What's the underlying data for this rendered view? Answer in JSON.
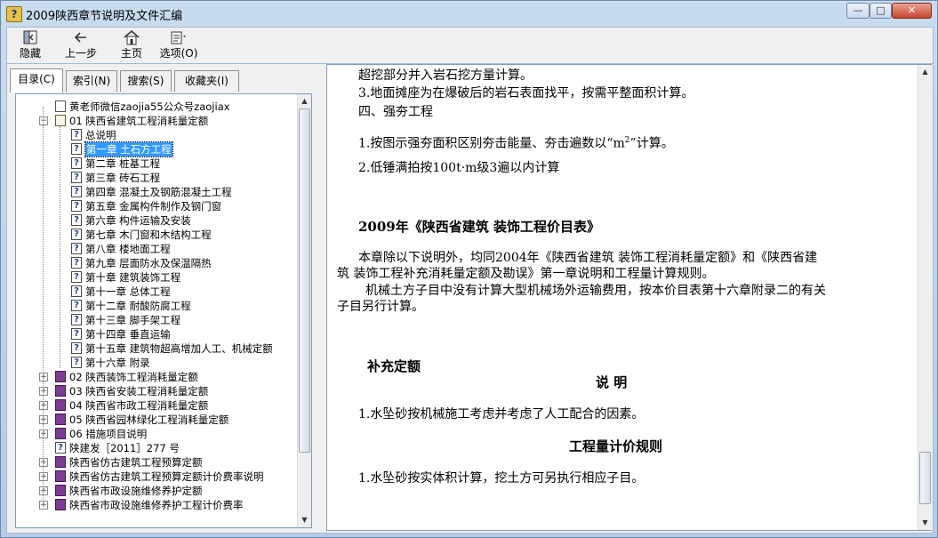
{
  "window": {
    "title": "2009陕西章节说明及文件汇编",
    "app_icon_glyph": "?",
    "buttons": {
      "minimize": "—",
      "maximize": "□",
      "close": "✕"
    }
  },
  "toolbar": {
    "hide": {
      "label": "隐藏",
      "icon": "hide-icon"
    },
    "back": {
      "label": "上一步",
      "icon": "back-arrow-icon"
    },
    "home": {
      "label": "主页",
      "icon": "home-icon"
    },
    "options": {
      "label": "选项(O)",
      "icon": "options-icon"
    }
  },
  "tabs": [
    {
      "label": "目录(C)",
      "active": true
    },
    {
      "label": "索引(N)",
      "active": false
    },
    {
      "label": "搜索(S)",
      "active": false
    },
    {
      "label": "收藏夹(I)",
      "active": false
    }
  ],
  "tree": [
    {
      "label": "黄老师微信zaojia55公众号zaojiax",
      "icon": "doc-icon",
      "level": 0
    },
    {
      "label": "01 陕西省建筑工程消耗量定额",
      "icon": "open-book-icon",
      "level": 0,
      "toggle": "−"
    },
    {
      "label": "总说明",
      "icon": "help-icon",
      "level": 1
    },
    {
      "label": "第一章 土石方工程",
      "icon": "help-icon",
      "level": 1,
      "selected": true
    },
    {
      "label": "第二章 桩基工程",
      "icon": "help-icon",
      "level": 1
    },
    {
      "label": "第三章 砖石工程",
      "icon": "help-icon",
      "level": 1
    },
    {
      "label": "第四章 混凝土及钢筋混凝土工程",
      "icon": "help-icon",
      "level": 1
    },
    {
      "label": "第五章 金属构件制作及钢门窗",
      "icon": "help-icon",
      "level": 1
    },
    {
      "label": "第六章 构件运输及安装",
      "icon": "help-icon",
      "level": 1
    },
    {
      "label": "第七章 木门窗和木结构工程",
      "icon": "help-icon",
      "level": 1
    },
    {
      "label": "第八章 楼地面工程",
      "icon": "help-icon",
      "level": 1
    },
    {
      "label": "第九章 层面防水及保温隔热",
      "icon": "help-icon",
      "level": 1
    },
    {
      "label": "第十章 建筑装饰工程",
      "icon": "help-icon",
      "level": 1
    },
    {
      "label": "第十一章 总体工程",
      "icon": "help-icon",
      "level": 1
    },
    {
      "label": "第十二章 耐酸防腐工程",
      "icon": "help-icon",
      "level": 1
    },
    {
      "label": "第十三章 脚手架工程",
      "icon": "help-icon",
      "level": 1
    },
    {
      "label": "第十四章 垂直运输",
      "icon": "help-icon",
      "level": 1
    },
    {
      "label": "第十五章 建筑物超高增加人工、机械定额",
      "icon": "help-icon",
      "level": 1
    },
    {
      "label": "第十六章 附录",
      "icon": "help-icon",
      "level": 1
    },
    {
      "label": "02 陕西装饰工程消耗量定额",
      "icon": "book-icon",
      "level": 0,
      "toggle": "+"
    },
    {
      "label": "03 陕西省安装工程消耗量定额",
      "icon": "book-icon",
      "level": 0,
      "toggle": "+"
    },
    {
      "label": "04 陕西省市政工程消耗量定额",
      "icon": "book-icon",
      "level": 0,
      "toggle": "+"
    },
    {
      "label": "05 陕西省园林绿化工程消耗量定额",
      "icon": "book-icon",
      "level": 0,
      "toggle": "+"
    },
    {
      "label": "06 措施项目说明",
      "icon": "book-icon",
      "level": 0,
      "toggle": "+"
    },
    {
      "label": "陕建发［2011］277 号",
      "icon": "help-icon",
      "level": 0
    },
    {
      "label": "陕西省仿古建筑工程预算定额",
      "icon": "book-icon",
      "level": 0,
      "toggle": "+"
    },
    {
      "label": "陕西省仿古建筑工程预算定额计价费率说明",
      "icon": "book-icon",
      "level": 0,
      "toggle": "+"
    },
    {
      "label": "陕西省市政设施维修养护定额",
      "icon": "book-icon",
      "level": 0,
      "toggle": "+"
    },
    {
      "label": "陕西省市政设施维修养护工程计价费率",
      "icon": "book-icon",
      "level": 0,
      "toggle": "+"
    }
  ],
  "content": {
    "line1": "超挖部分并入岩石挖方量计算。",
    "line2": "3.地面摊座为在爆破后的岩石表面找平，按需平整面积计算。",
    "line3": "四、强夯工程",
    "line4_pre": "1.按图示强夯面积区别夯击能量、夯击遍数以“m",
    "line4_sup": "2",
    "line4_post": "”计算。",
    "line5": "2.低锤满拍按100t·m级3遍以内计算",
    "heading1": "2009年《陕西省建筑 装饰工程价目表》",
    "para1a": "本章除以下说明外，均同2004年《陕西省建筑 装饰工程消耗量定额》和《陕西省建",
    "para1b": "筑  装饰工程补充消耗量定额及勘误》第一章说明和工程量计算规则。",
    "para2a": "机械土方子目中没有计算大型机械场外运输费用，按本价目表第十六章附录二的有关",
    "para2b": "子目另行计算。",
    "heading2": "补充定额",
    "heading3": "说    明",
    "line6": "1.水坠砂按机械施工考虑并考虑了人工配合的因素。",
    "heading4": "工程量计价规则",
    "line7": "1.水坠砂按实体积计算，挖土方可另执行相应子目。"
  },
  "scrollbars": {
    "nav": {
      "position": 0.0,
      "visible_fraction": 0.85
    },
    "content": {
      "position": 0.97,
      "visible_fraction": 0.12
    }
  }
}
